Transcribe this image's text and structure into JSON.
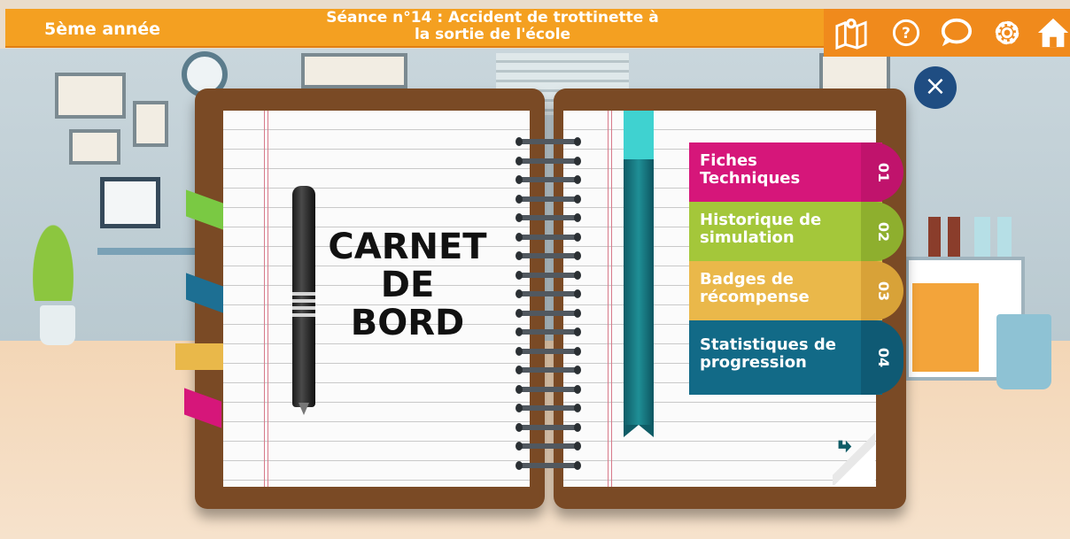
{
  "header": {
    "grade": "5ème année",
    "title_line1": "Séance n°14 : Accident de trottinette à",
    "title_line2": "la sortie de l'école"
  },
  "toolbar": {
    "icons": [
      "map-icon",
      "help-icon",
      "chat-icon",
      "settings-icon",
      "home-icon"
    ]
  },
  "close_label": "×",
  "notebook": {
    "title_lines": [
      "CARNET",
      "DE",
      "BORD"
    ]
  },
  "menu": [
    {
      "line1": "Fiches",
      "line2": "Techniques",
      "number": "01",
      "color": "#d6167a",
      "num_color": "#c0136c"
    },
    {
      "line1": "Historique",
      "line2": "de simulation",
      "number": "02",
      "color": "#a4c73a",
      "num_color": "#8eaf2e"
    },
    {
      "line1": "Badges de",
      "line2": "récompense",
      "number": "03",
      "color": "#eab84a",
      "num_color": "#d8a238"
    },
    {
      "line1": "Statistiques",
      "line2": "de progression",
      "number": "04",
      "color": "#126a87",
      "num_color": "#0f5a74"
    }
  ],
  "colors": {
    "topbar": "#f4a021",
    "close_button": "#1f4d82",
    "cover": "#7a4a25",
    "ribbon": "#1f8f96"
  }
}
